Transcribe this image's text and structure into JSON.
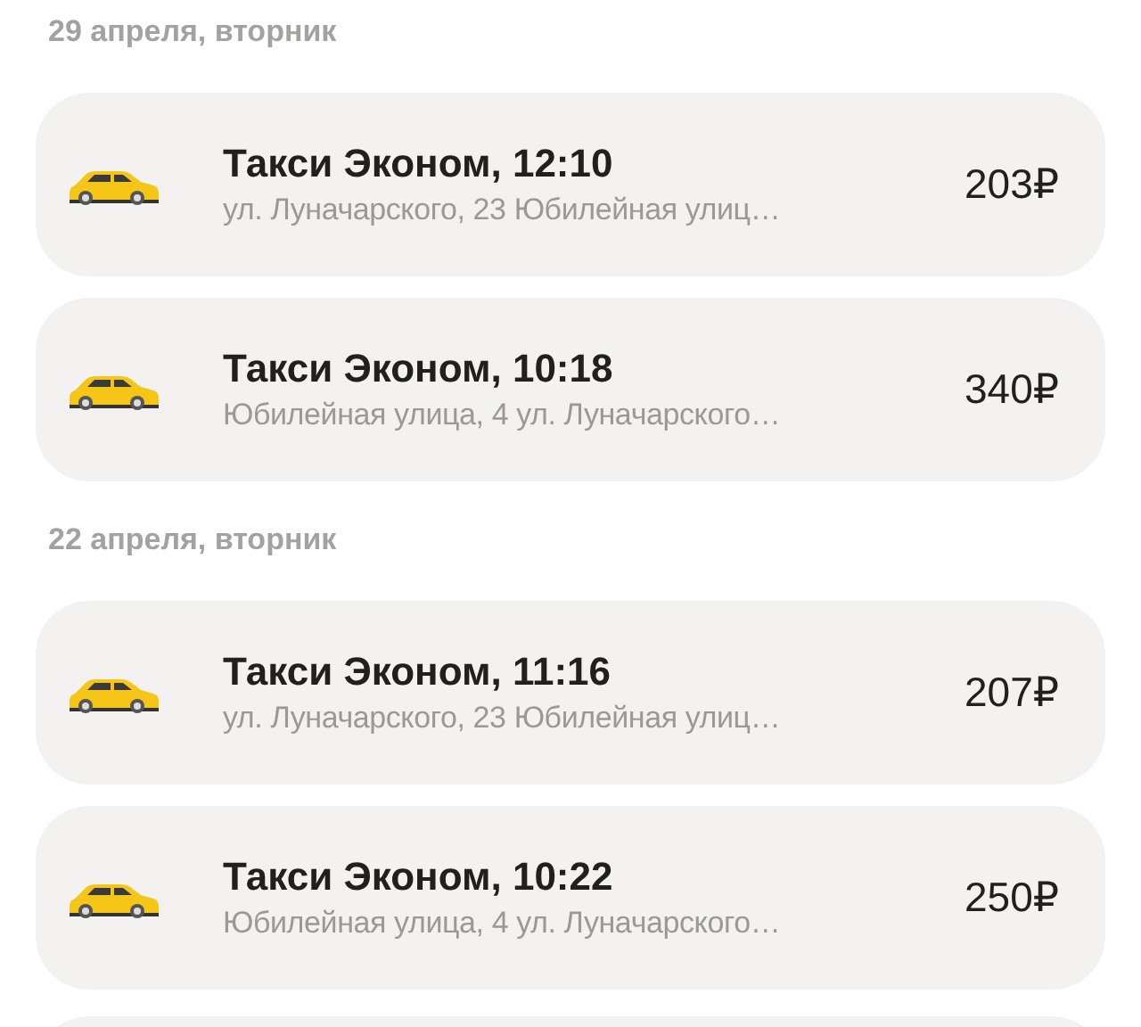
{
  "groups": [
    {
      "date": "29 апреля, вторник",
      "rides": [
        {
          "title": "Такси Эконом, 12:10",
          "route": "ул. Луначарского, 23 Юбилейная улиц…",
          "price": "203₽"
        },
        {
          "title": "Такси Эконом, 10:18",
          "route": "Юбилейная улица, 4 ул. Луначарского…",
          "price": "340₽"
        }
      ]
    },
    {
      "date": "22 апреля, вторник",
      "rides": [
        {
          "title": "Такси Эконом, 11:16",
          "route": "ул. Луначарского, 23 Юбилейная улиц…",
          "price": "207₽"
        },
        {
          "title": "Такси Эконом, 10:22",
          "route": "Юбилейная улица, 4 ул. Луначарского…",
          "price": "250₽"
        }
      ]
    }
  ]
}
